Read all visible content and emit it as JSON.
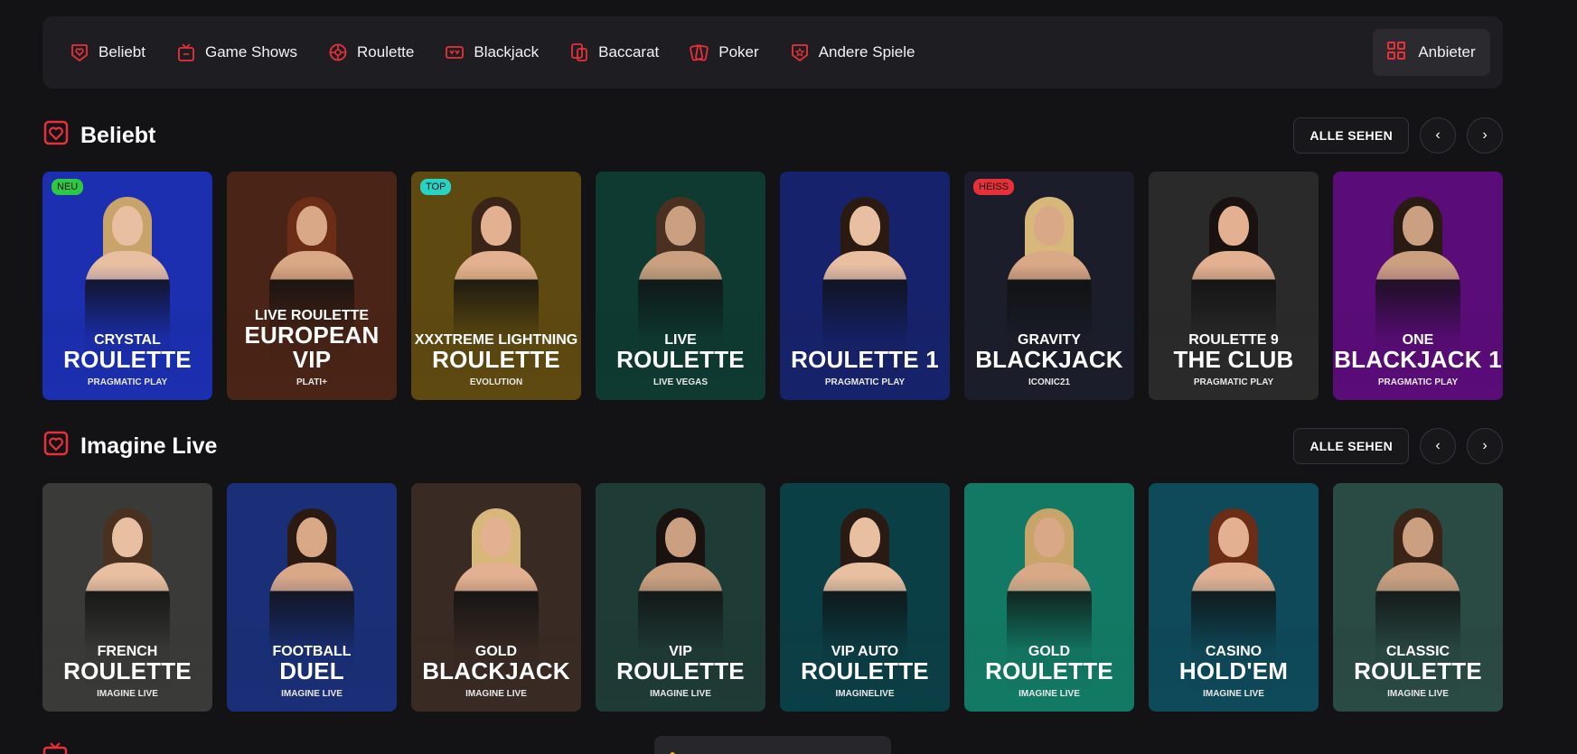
{
  "nav": {
    "items": [
      {
        "label": "Beliebt",
        "icon": "heart-icon"
      },
      {
        "label": "Game Shows",
        "icon": "tv-icon"
      },
      {
        "label": "Roulette",
        "icon": "roulette-icon"
      },
      {
        "label": "Blackjack",
        "icon": "blackjack-icon"
      },
      {
        "label": "Baccarat",
        "icon": "baccarat-icon"
      },
      {
        "label": "Poker",
        "icon": "poker-icon"
      },
      {
        "label": "Andere Spiele",
        "icon": "star-icon"
      }
    ],
    "provider_label": "Anbieter"
  },
  "accent_color": "#e8303a",
  "sections": [
    {
      "title": "Beliebt",
      "see_all": "ALLE SEHEN",
      "cards": [
        {
          "badge": "NEU",
          "badge_color": "#2ec942",
          "t1": "CRYSTAL",
          "t2": "ROULETTE",
          "provider": "PRAGMATIC PLAY",
          "bg": "#1b2fb0"
        },
        {
          "badge": "",
          "t1": "LIVE ROULETTE",
          "t2": "EUROPEAN VIP",
          "provider": "PLATI+",
          "bg": "#4a2416"
        },
        {
          "badge": "TOP",
          "badge_color": "#27d4c4",
          "t1": "XXXTREME LIGHTNING",
          "t2": "ROULETTE",
          "provider": "EVOLUTION",
          "bg": "#5e4a10"
        },
        {
          "badge": "",
          "t1": "LIVE",
          "t2": "ROULETTE",
          "provider": "LIVE VEGAS",
          "bg": "#0e3a32"
        },
        {
          "badge": "",
          "t1": "",
          "t2": "ROULETTE 1",
          "provider": "PRAGMATIC PLAY",
          "bg": "#16226b"
        },
        {
          "badge": "HEISS",
          "badge_color": "#e8303a",
          "t1": "GRAVITY",
          "t2": "BLACKJACK",
          "provider": "ICONIC21",
          "bg": "#1b1e2a"
        },
        {
          "badge": "",
          "t1": "ROULETTE 9",
          "t2": "THE CLUB",
          "provider": "PRAGMATIC PLAY",
          "bg": "#2a2a2a"
        },
        {
          "badge": "",
          "t1": "ONE",
          "t2": "BLACKJACK 1",
          "provider": "PRAGMATIC PLAY",
          "bg": "#5a0c78"
        }
      ]
    },
    {
      "title": "Imagine Live",
      "see_all": "ALLE SEHEN",
      "cards": [
        {
          "badge": "",
          "t1": "FRENCH",
          "t2": "ROULETTE",
          "provider": "IMAGINE LIVE",
          "bg": "#3a3a38"
        },
        {
          "badge": "",
          "t1": "FOOTBALL",
          "t2": "DUEL",
          "provider": "IMAGINE LIVE",
          "bg": "#1a2f78"
        },
        {
          "badge": "",
          "t1": "GOLD",
          "t2": "BLACKJACK",
          "provider": "IMAGINE LIVE",
          "bg": "#3a2a24"
        },
        {
          "badge": "",
          "t1": "VIP",
          "t2": "ROULETTE",
          "provider": "IMAGINE LIVE",
          "bg": "#1f3b36"
        },
        {
          "badge": "",
          "t1": "VIP AUTO",
          "t2": "ROULETTE",
          "provider": "IMAGINELIVE",
          "bg": "#0b3f46"
        },
        {
          "badge": "",
          "t1": "GOLD",
          "t2": "ROULETTE",
          "provider": "IMAGINE LIVE",
          "bg": "#127a64"
        },
        {
          "badge": "",
          "t1": "CASINO",
          "t2": "HOLD'EM",
          "provider": "IMAGINE LIVE",
          "bg": "#0e4a5a"
        },
        {
          "badge": "",
          "t1": "CLASSIC",
          "t2": "ROULETTE",
          "provider": "IMAGINE LIVE",
          "bg": "#2a4a44"
        }
      ]
    }
  ]
}
